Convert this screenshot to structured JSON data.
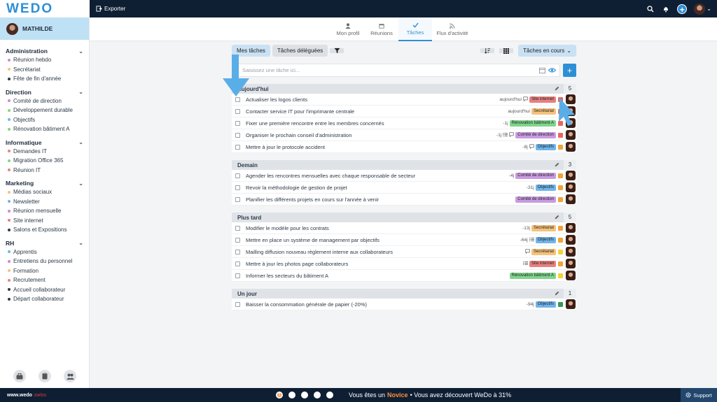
{
  "app": {
    "logo": "WEDO",
    "export_label": "Exporter"
  },
  "user": {
    "name": "MATHILDE"
  },
  "sidebar": {
    "groups": [
      {
        "title": "Administration",
        "items": [
          {
            "label": "Réunion hebdo",
            "color": "#c78bd1"
          },
          {
            "label": "Secrétariat",
            "color": "#f5c27a"
          },
          {
            "label": "Fête de fin d'année",
            "color": "#2d3a4a"
          }
        ]
      },
      {
        "title": "Direction",
        "items": [
          {
            "label": "Comité de direction",
            "color": "#c78bd1"
          },
          {
            "label": "Développement durable",
            "color": "#8bd17f"
          },
          {
            "label": "Objectifs",
            "color": "#6fb5ea"
          },
          {
            "label": "Rénovation bâtiment A",
            "color": "#8bd17f"
          }
        ]
      },
      {
        "title": "Informatique",
        "items": [
          {
            "label": "Demandes IT",
            "color": "#e88080"
          },
          {
            "label": "Migration Office 365",
            "color": "#8bd17f"
          },
          {
            "label": "Réunion IT",
            "color": "#e88080"
          }
        ]
      },
      {
        "title": "Marketing",
        "items": [
          {
            "label": "Médias sociaux",
            "color": "#f5c27a"
          },
          {
            "label": "Newsletter",
            "color": "#6fb5ea"
          },
          {
            "label": "Réunion mensuelle",
            "color": "#c78bd1"
          },
          {
            "label": "Site internet",
            "color": "#e88080"
          },
          {
            "label": "Salons et Expositions",
            "color": "#2d3a4a"
          }
        ]
      },
      {
        "title": "RH",
        "items": [
          {
            "label": "Apprentis",
            "color": "#6fb5ea"
          },
          {
            "label": "Entretiens du personnel",
            "color": "#c78bd1"
          },
          {
            "label": "Formation",
            "color": "#f5c27a"
          },
          {
            "label": "Recrutement",
            "color": "#e88080"
          },
          {
            "label": "Accueil collaborateur",
            "color": "#2d3a4a"
          },
          {
            "label": "Départ collaborateur",
            "color": "#2d3a4a"
          }
        ]
      }
    ]
  },
  "tabs": [
    {
      "label": "Mon profil",
      "icon": "user-icon"
    },
    {
      "label": "Réunions",
      "icon": "calendar-icon"
    },
    {
      "label": "Tâches",
      "icon": "check-icon",
      "active": true
    },
    {
      "label": "Flux d'activité",
      "icon": "rss-icon"
    }
  ],
  "toolbar": {
    "my_tasks": "Mes tâches",
    "delegated": "Tâches déléguées",
    "status": "Tâches en cours"
  },
  "task_input": {
    "placeholder": "Saisissez une tâche ici..."
  },
  "sections": [
    {
      "title": "Aujourd'hui",
      "count": "5",
      "tasks": [
        {
          "text": "Actualiser les logos clients",
          "date": "aujourd'hui",
          "icons": "comment",
          "tag": "Site internet",
          "tag_color": "#e88080",
          "sq": "#e8675c"
        },
        {
          "text": "Contacter service IT pour l'imprimante centrale",
          "date": "aujourd'hui",
          "icons": "",
          "tag": "Secrétariat",
          "tag_color": "#f5c27a",
          "sq": "#e8675c"
        },
        {
          "text": "Fixer une première rencontre entre les membres concernés",
          "date": "-1j",
          "icons": "",
          "tag": "Rénovation bâtiment A",
          "tag_color": "#7fd48b",
          "sq": "#e8675c"
        },
        {
          "text": "Organiser le prochain conseil d'administration",
          "date": "-1j",
          "icons": "list comment",
          "tag": "Comité de direction",
          "tag_color": "#c99be0",
          "sq": "#e8675c"
        },
        {
          "text": "Mettre à jour le protocole accident",
          "date": "-8j",
          "icons": "comment",
          "tag": "Objectifs",
          "tag_color": "#6fb5ea",
          "sq": "#f0a33a"
        }
      ]
    },
    {
      "title": "Demain",
      "count": "3",
      "tasks": [
        {
          "text": "Agender les rencontres mensuelles avec chaque responsable de secteur",
          "date": "-4j",
          "icons": "",
          "tag": "Comité de direction",
          "tag_color": "#c99be0",
          "sq": "#f0a33a"
        },
        {
          "text": "Revoir la méthodologie de gestion de projet",
          "date": "-31j",
          "icons": "",
          "tag": "Objectifs",
          "tag_color": "#6fb5ea",
          "sq": "#f0a33a"
        },
        {
          "text": "Planifier les différents projets en cours sur l'année à venir",
          "date": "",
          "icons": "",
          "tag": "Comité de direction",
          "tag_color": "#c99be0",
          "sq": "#f0a33a"
        }
      ]
    },
    {
      "title": "Plus tard",
      "count": "5",
      "tasks": [
        {
          "text": "Modifier le modèle pour les contrats",
          "date": "-13j",
          "icons": "",
          "tag": "Secrétariat",
          "tag_color": "#f5c27a",
          "sq": "#f0a33a"
        },
        {
          "text": "Mettre en place un système de management par objectifs",
          "date": "-64j",
          "icons": "list",
          "tag": "Objectifs",
          "tag_color": "#6fb5ea",
          "sq": "#f0a33a"
        },
        {
          "text": "Mailling diffusion nouveau règlement interne aux collaborateurs",
          "date": "",
          "icons": "comment",
          "tag": "Secrétariat",
          "tag_color": "#f5c27a",
          "sq": "#f5d13a"
        },
        {
          "text": "Mettre à jour les photos page collaborateurs",
          "date": "",
          "icons": "list",
          "tag": "Site internet",
          "tag_color": "#e88080",
          "sq": "#f0a33a"
        },
        {
          "text": "Informer les secteurs du bâtiment A",
          "date": "",
          "icons": "",
          "tag": "Rénovation bâtiment A",
          "tag_color": "#7fd48b",
          "sq": "#f5d13a"
        }
      ]
    },
    {
      "title": "Un jour",
      "count": "1",
      "tasks": [
        {
          "text": "Baisser la consommation générale de papier (-20%)",
          "date": "-94j",
          "icons": "",
          "tag": "Objectifs",
          "tag_color": "#6fb5ea",
          "sq": "#2e9a5a"
        }
      ]
    }
  ],
  "bottom": {
    "brand": "www.wedo",
    "brand_suffix": ".swiss",
    "msg_prefix": "Vous êtes un",
    "level": "Novice",
    "msg_suffix": "• Vous avez découvert WeDo à 31%",
    "support": "Support",
    "steps": [
      "1",
      "",
      "",
      "",
      ""
    ]
  }
}
